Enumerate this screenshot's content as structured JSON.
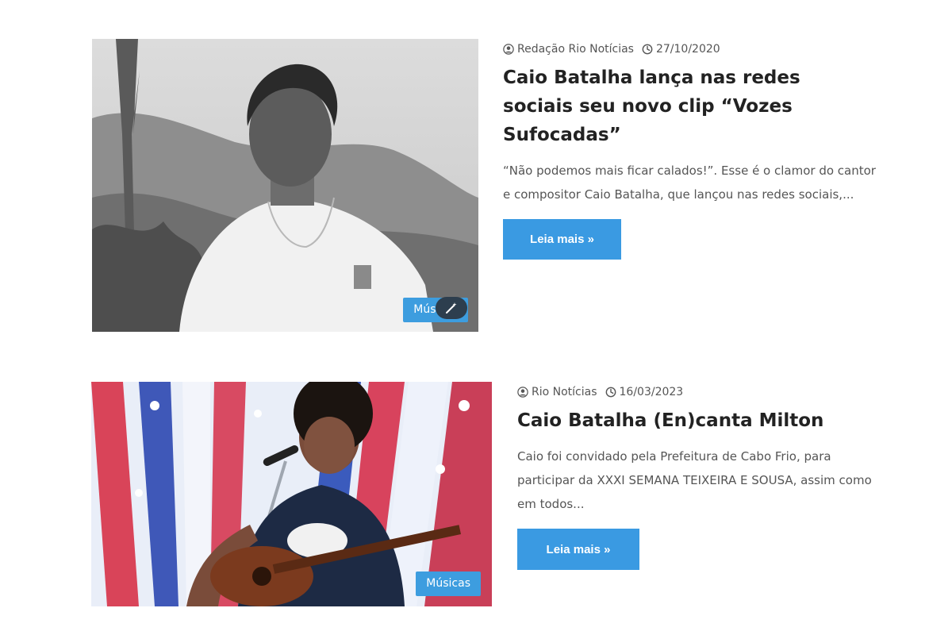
{
  "posts": [
    {
      "author": "Redação Rio Notícias",
      "date": "27/10/2020",
      "title": "Caio Batalha lança nas redes sociais seu novo clip “Vozes Sufocadas”",
      "excerpt": "“Não podemos mais ficar calados!”. Esse é o clamor do cantor e compositor Caio Batalha, que lançou nas redes sociais,...",
      "button_label": "Leia mais »",
      "category": "Músicas",
      "image_alt": "Caio Batalha em paisagem montanhosa, foto em tons de cinza"
    },
    {
      "author": "Rio Notícias",
      "date": "16/03/2023",
      "title": "Caio Batalha (En)canta Milton",
      "excerpt": "Caio foi convidado pela Prefeitura de Cabo Frio, para participar da XXXI SEMANA TEIXEIRA E SOUSA, assim como em todos...",
      "button_label": "Leia mais »",
      "category": "Músicas",
      "image_alt": "Caio Batalha cantando e tocando violão no palco"
    }
  ],
  "icons": {
    "author": "user-circle-icon",
    "date": "clock-icon",
    "magic": "magic-wand-icon"
  },
  "colors": {
    "button": "#3a9ae2",
    "badge": "#3d9ddf",
    "title": "#222222",
    "text": "#555555"
  }
}
